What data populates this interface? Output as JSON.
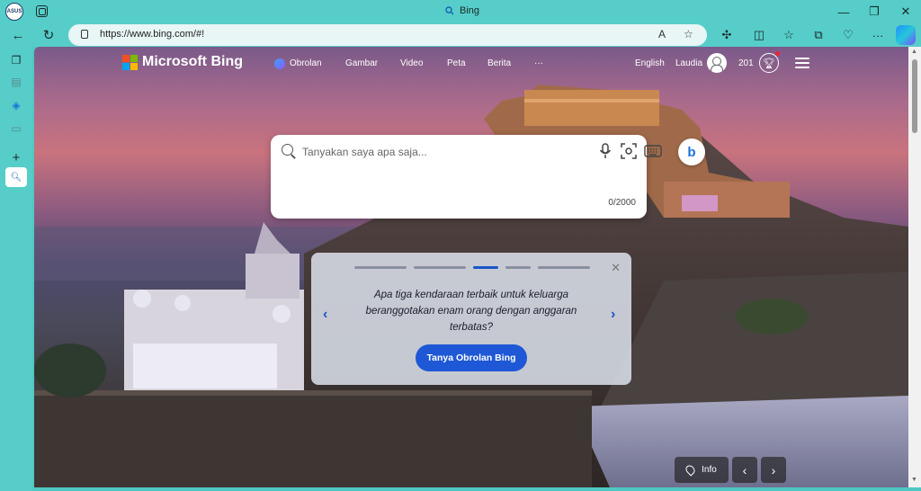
{
  "browser": {
    "profile_label": "ASUS",
    "tab_title": "Bing",
    "url": "https://www.bing.com/#!",
    "read_aloud_label": "A",
    "window_controls": {
      "minimize": "—",
      "restore": "❐",
      "close": "✕"
    },
    "toolbar_more": "···"
  },
  "bing": {
    "logo_text": "Microsoft Bing",
    "nav": [
      "Obrolan",
      "Gambar",
      "Video",
      "Peta",
      "Berita",
      "···"
    ],
    "language": "English",
    "user_name": "Laudia",
    "reward_points": "201"
  },
  "search": {
    "placeholder": "Tanyakan saya apa saja...",
    "char_count": "0/2000"
  },
  "suggestion": {
    "text": "Apa tiga kendaraan terbaik untuk keluarga beranggotakan enam orang dengan anggaran terbatas?",
    "button_label": "Tanya Obrolan Bing",
    "prev": "‹",
    "next": "›",
    "close": "✕"
  },
  "footer": {
    "info_label": "Info",
    "prev": "‹",
    "next": "›"
  },
  "colors": {
    "accent": "#1e58d6",
    "browser_frame": "#56cdc8"
  },
  "icons": [
    "profile-icon",
    "collections-icon",
    "search-icon",
    "back-icon",
    "refresh-icon",
    "lock-icon",
    "read-aloud-icon",
    "favorite-icon",
    "extensions-icon",
    "split-screen-icon",
    "favorites-icon",
    "collections-icon",
    "performance-icon",
    "more-icon",
    "copilot-icon",
    "microphone-icon",
    "visual-search-icon",
    "keyboard-icon",
    "bing-chat-icon",
    "rewards-icon",
    "menu-icon",
    "location-pin-icon"
  ]
}
